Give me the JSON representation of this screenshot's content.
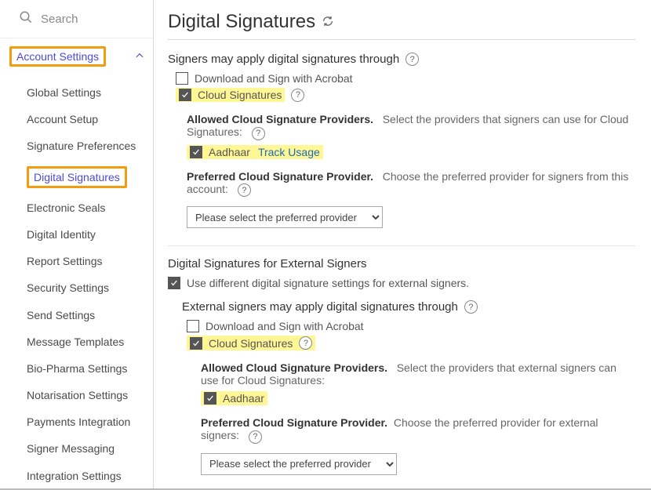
{
  "search": {
    "placeholder": "Search"
  },
  "sidebar": {
    "section_label": "Account Settings",
    "items": [
      {
        "label": "Global Settings"
      },
      {
        "label": "Account Setup"
      },
      {
        "label": "Signature Preferences"
      },
      {
        "label": "Digital Signatures",
        "active": true
      },
      {
        "label": "Electronic Seals"
      },
      {
        "label": "Digital Identity"
      },
      {
        "label": "Report Settings"
      },
      {
        "label": "Security Settings"
      },
      {
        "label": "Send Settings"
      },
      {
        "label": "Message Templates"
      },
      {
        "label": "Bio-Pharma Settings"
      },
      {
        "label": "Notarisation Settings"
      },
      {
        "label": "Payments Integration"
      },
      {
        "label": "Signer Messaging"
      },
      {
        "label": "Integration Settings"
      }
    ]
  },
  "page": {
    "title": "Digital Signatures"
  },
  "section1": {
    "title": "Signers may apply digital signatures through",
    "opt_download": "Download and Sign with Acrobat",
    "opt_cloud": "Cloud Signatures",
    "allowed": {
      "label": "Allowed Cloud Signature Providers.",
      "desc": "Select the providers that signers can use for Cloud Signatures:",
      "provider": "Aadhaar",
      "track": "Track Usage"
    },
    "preferred": {
      "label": "Preferred Cloud Signature Provider.",
      "desc": "Choose the preferred provider for signers from this account:",
      "placeholder": "Please select the preferred provider"
    }
  },
  "section2": {
    "title": "Digital Signatures for External Signers",
    "opt_diff": "Use different digital signature settings for external signers.",
    "sub_title": "External signers may apply digital signatures through",
    "opt_download": "Download and Sign with Acrobat",
    "opt_cloud": "Cloud Signatures",
    "allowed": {
      "label": "Allowed Cloud Signature Providers.",
      "desc": "Select the providers that external signers can use for Cloud Signatures:",
      "provider": "Aadhaar"
    },
    "preferred": {
      "label": "Preferred Cloud Signature Provider.",
      "desc": "Choose the preferred provider for external signers:",
      "placeholder": "Please select the preferred provider"
    }
  }
}
